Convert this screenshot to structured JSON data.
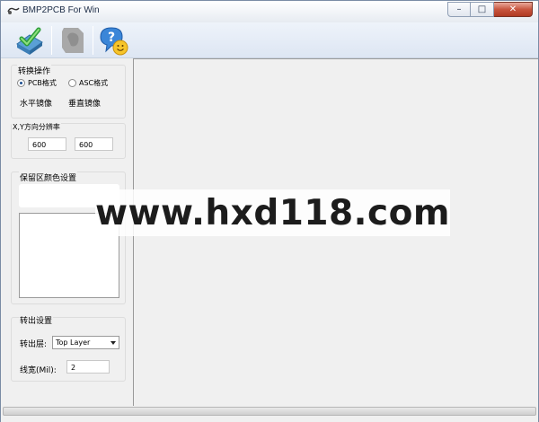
{
  "window": {
    "title": "BMP2PCB For Win",
    "close_glyph": "✕",
    "max_glyph": "□",
    "min_glyph": "–"
  },
  "toolbar": {
    "buttons": [
      {
        "icon": "convert-icon"
      },
      {
        "icon": "board-icon"
      },
      {
        "icon": "help-smiley-icon"
      }
    ]
  },
  "convert_group": {
    "title": "转换操作",
    "radio_pcb": "PCB格式",
    "radio_asc": "ASC格式",
    "pcb_checked": true,
    "mirror_h": "水平镜像",
    "mirror_v": "垂直镜像"
  },
  "resolution_group": {
    "title": "X,Y方向分辨率",
    "x_value": "600",
    "y_value": "600"
  },
  "color_group": {
    "title": "保留区颜色设置"
  },
  "output_group": {
    "title": "转出设置",
    "layer_label": "转出层:",
    "layer_value": "Top  Layer",
    "width_label": "线宽(Mil):",
    "width_value": "2"
  },
  "watermark": {
    "text": "www.hxd118.com"
  }
}
